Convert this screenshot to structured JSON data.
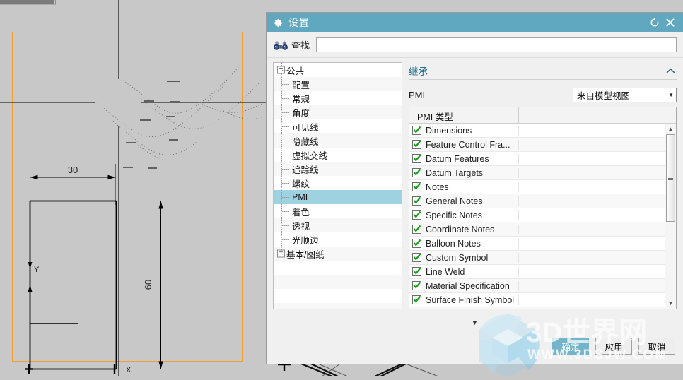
{
  "app": {
    "background": "cad-drawing-canvas",
    "bg_color": "#c8c8c8"
  },
  "cad": {
    "dim_width_label": "30",
    "dim_height_label": "60",
    "axis_x_label": "X",
    "axis_y_label": "Y",
    "selection_color": "#f0a martins"
  },
  "dialog": {
    "title": "设置",
    "title_icon": "gear-icon",
    "accent_color": "#5fa8bf",
    "reset_icon": "reset-icon",
    "close_icon": "close-icon",
    "search": {
      "icon": "binoculars-icon",
      "label": "查找",
      "value": "",
      "placeholder": ""
    },
    "tree": {
      "items": [
        {
          "label": "公共",
          "level": 0,
          "expander": "−",
          "selected": false
        },
        {
          "label": "配置",
          "level": 1,
          "expander": "",
          "selected": false
        },
        {
          "label": "常规",
          "level": 1,
          "expander": "",
          "selected": false
        },
        {
          "label": "角度",
          "level": 1,
          "expander": "",
          "selected": false
        },
        {
          "label": "可见线",
          "level": 1,
          "expander": "",
          "selected": false
        },
        {
          "label": "隐藏线",
          "level": 1,
          "expander": "",
          "selected": false
        },
        {
          "label": "虚拟交线",
          "level": 1,
          "expander": "",
          "selected": false
        },
        {
          "label": "追踪线",
          "level": 1,
          "expander": "",
          "selected": false
        },
        {
          "label": "螺纹",
          "level": 1,
          "expander": "",
          "selected": false
        },
        {
          "label": "PMI",
          "level": 1,
          "expander": "",
          "selected": true
        },
        {
          "label": "着色",
          "level": 1,
          "expander": "",
          "selected": false
        },
        {
          "label": "透视",
          "level": 1,
          "expander": "",
          "selected": false
        },
        {
          "label": "光顺边",
          "level": 1,
          "expander": "",
          "selected": false
        },
        {
          "label": "基本/图纸",
          "level": 0,
          "expander": "+",
          "selected": false
        }
      ]
    },
    "section": {
      "title": "继承",
      "collapse_icon": "chevron-up-icon"
    },
    "pmi_field": {
      "label": "PMI",
      "dropdown_value": "来自模型视图",
      "dropdown_icon": "chevron-down-icon"
    },
    "grid": {
      "header": "PMI 类型",
      "header_col2": "",
      "rows": [
        {
          "label": "Dimensions",
          "checked": true
        },
        {
          "label": "Feature Control Fra...",
          "checked": true
        },
        {
          "label": "Datum Features",
          "checked": true
        },
        {
          "label": "Datum Targets",
          "checked": true
        },
        {
          "label": "Notes",
          "checked": true
        },
        {
          "label": "General Notes",
          "checked": true
        },
        {
          "label": "Specific Notes",
          "checked": true
        },
        {
          "label": "Coordinate Notes",
          "checked": true
        },
        {
          "label": "Balloon Notes",
          "checked": true
        },
        {
          "label": "Custom Symbol",
          "checked": true
        },
        {
          "label": "Line Weld",
          "checked": true
        },
        {
          "label": "Material Specification",
          "checked": true
        },
        {
          "label": "Surface Finish Symbol",
          "checked": true
        }
      ],
      "scrollbar": {
        "up_icon": "triangle-up-icon",
        "down_icon": "triangle-down-icon",
        "thumb_grip_icon": "grip-icon"
      }
    },
    "collapse_bar_icon": "chevron-down-icon",
    "buttons": {
      "ok": "确定",
      "apply": "应用",
      "cancel": "取消"
    }
  },
  "watermark": {
    "logo": "cube-logo",
    "text": "3D世界网",
    "url": "WWW.3DSJW.COM"
  }
}
